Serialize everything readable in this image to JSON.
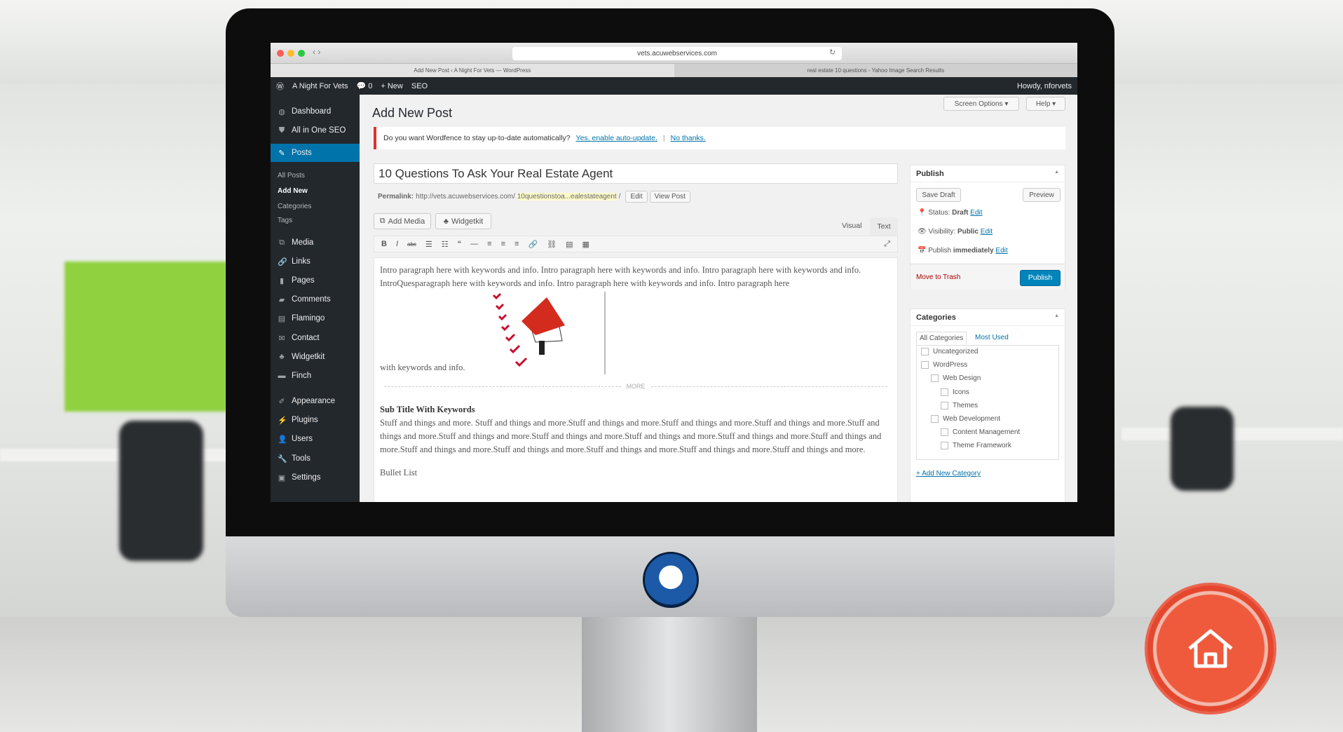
{
  "browser": {
    "url": "vets.acuwebservices.com",
    "tabs": [
      "Add New Post ‹ A Night For Vets — WordPress",
      "real estate 10 questions - Yahoo Image Search Results"
    ]
  },
  "adminbar": {
    "site": "A Night For Vets",
    "comments": "0",
    "new": "New",
    "seo": "SEO",
    "howdy": "Howdy, nforvets"
  },
  "sidebar": {
    "items": [
      {
        "label": "Dashboard",
        "icon": "dashboard-icon"
      },
      {
        "label": "All in One SEO",
        "icon": "seo-icon"
      },
      {
        "label": "Posts",
        "icon": "pin-icon"
      },
      {
        "label": "Media",
        "icon": "media-icon"
      },
      {
        "label": "Links",
        "icon": "link-icon"
      },
      {
        "label": "Pages",
        "icon": "pages-icon"
      },
      {
        "label": "Comments",
        "icon": "comment-icon"
      },
      {
        "label": "Flamingo",
        "icon": "flamingo-icon"
      },
      {
        "label": "Contact",
        "icon": "mail-icon"
      },
      {
        "label": "Widgetkit",
        "icon": "widgetkit-icon"
      },
      {
        "label": "Finch",
        "icon": "finch-icon"
      },
      {
        "label": "Appearance",
        "icon": "brush-icon"
      },
      {
        "label": "Plugins",
        "icon": "plugin-icon"
      },
      {
        "label": "Users",
        "icon": "user-icon"
      },
      {
        "label": "Tools",
        "icon": "wrench-icon"
      },
      {
        "label": "Settings",
        "icon": "settings-icon"
      }
    ],
    "posts_sub": [
      "All Posts",
      "Add New",
      "Categories",
      "Tags"
    ]
  },
  "header": {
    "title": "Add New Post",
    "screen_options": "Screen Options ▾",
    "help": "Help ▾"
  },
  "notice": {
    "text": "Do you want Wordfence to stay up-to-date automatically?",
    "yes": "Yes, enable auto-update.",
    "sep": "|",
    "no": "No thanks."
  },
  "post": {
    "title": "10 Questions To Ask Your Real Estate Agent",
    "permalink_label": "Permalink:",
    "permalink_base": "http://vets.acuwebservices.com/",
    "permalink_slug": "10questionstoa...ealestateagent",
    "permalink_end": "/",
    "edit": "Edit",
    "view": "View Post"
  },
  "editor": {
    "add_media": "Add Media",
    "widgetkit": "Widgetkit",
    "visual": "Visual",
    "text": "Text",
    "intro": "Intro paragraph here with keywords and info. Intro paragraph here with keywords and info. Intro paragraph here with keywords and info. IntroQuesparagraph here with keywords and info. Intro paragraph here with keywords and info. Intro paragraph here",
    "intro_end": "with keywords and info.",
    "more": "MORE",
    "subtitle": "Sub Title With Keywords",
    "body": "Stuff and things and more. Stuff and things and more.Stuff and things and more.Stuff and things and more.Stuff and things and more.Stuff and things and more.Stuff and things and more.Stuff and things and more.Stuff and things and more.Stuff and things and more.Stuff and things and more.Stuff and things and more.Stuff and things and more.Stuff and things and more.Stuff and things and more.Stuff and things and more.",
    "bullet": "Bullet List"
  },
  "publish": {
    "title": "Publish",
    "save_draft": "Save Draft",
    "preview": "Preview",
    "status_label": "Status:",
    "status": "Draft",
    "visibility_label": "Visibility:",
    "visibility": "Public",
    "publish_label": "Publish",
    "publish_when": "immediately",
    "edit": "Edit",
    "trash": "Move to Trash",
    "publish_btn": "Publish"
  },
  "categories": {
    "title": "Categories",
    "tab_all": "All Categories",
    "tab_most": "Most Used",
    "items": [
      "Uncategorized",
      "WordPress",
      "Web Design",
      "Icons",
      "Themes",
      "Web Development",
      "Content Management",
      "Theme Framework"
    ],
    "add": "+ Add New Category"
  },
  "colors": {
    "accent": "#0073aa",
    "sidebar": "#23282d",
    "notice": "#dc3232",
    "home_button": "#ef5a3c"
  }
}
